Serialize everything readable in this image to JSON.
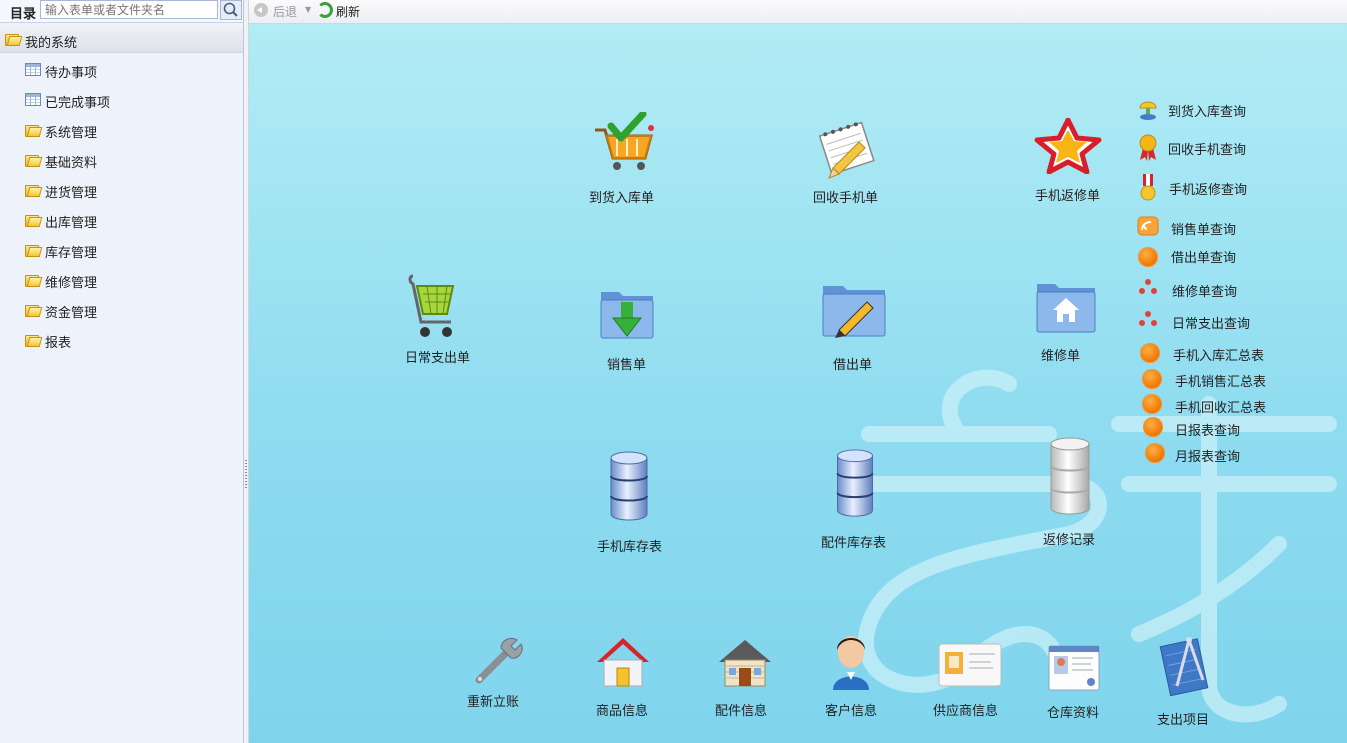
{
  "sidebar": {
    "search_label": "目录",
    "search_placeholder": "输入表单或者文件夹名",
    "root_label": "我的系统",
    "items": [
      {
        "label": "待办事项",
        "icon": "table-icon"
      },
      {
        "label": "已完成事项",
        "icon": "table-icon"
      },
      {
        "label": "系统管理",
        "icon": "folder-icon"
      },
      {
        "label": "基础资料",
        "icon": "folder-icon"
      },
      {
        "label": "进货管理",
        "icon": "folder-icon"
      },
      {
        "label": "出库管理",
        "icon": "folder-icon"
      },
      {
        "label": "库存管理",
        "icon": "folder-icon"
      },
      {
        "label": "维修管理",
        "icon": "folder-icon"
      },
      {
        "label": "资金管理",
        "icon": "folder-icon"
      },
      {
        "label": "报表",
        "icon": "folder-icon"
      }
    ]
  },
  "toolbar": {
    "back_label": "后退",
    "refresh_label": "刷新"
  },
  "tiles": [
    {
      "label": "到货入库单",
      "icon": "shopping-cart-check-icon"
    },
    {
      "label": "回收手机单",
      "icon": "notepad-pencil-icon"
    },
    {
      "label": "手机返修单",
      "icon": "star-icon"
    },
    {
      "label": "日常支出单",
      "icon": "green-cart-icon"
    },
    {
      "label": "销售单",
      "icon": "folder-download-icon"
    },
    {
      "label": "借出单",
      "icon": "folder-pencil-icon"
    },
    {
      "label": "维修单",
      "icon": "folder-home-icon"
    },
    {
      "label": "手机库存表",
      "icon": "database-icon"
    },
    {
      "label": "配件库存表",
      "icon": "database-icon"
    },
    {
      "label": "返修记录",
      "icon": "database-white-icon"
    },
    {
      "label": "重新立账",
      "icon": "wrench-icon"
    },
    {
      "label": "商品信息",
      "icon": "house-icon"
    },
    {
      "label": "配件信息",
      "icon": "cabin-icon"
    },
    {
      "label": "客户信息",
      "icon": "person-icon"
    },
    {
      "label": "供应商信息",
      "icon": "business-card-icon"
    },
    {
      "label": "仓库资料",
      "icon": "id-card-icon"
    },
    {
      "label": "支出项目",
      "icon": "blueprint-compass-icon"
    }
  ],
  "queries": [
    {
      "label": "到货入库查询",
      "icon": "lamp-icon"
    },
    {
      "label": "回收手机查询",
      "icon": "award-ribbon-icon"
    },
    {
      "label": "手机返修查询",
      "icon": "medal-icon"
    },
    {
      "label": "销售单查询",
      "icon": "rss-icon"
    },
    {
      "label": "借出单查询",
      "icon": "orange-dot-icon"
    },
    {
      "label": "维修单查询",
      "icon": "red-dots-icon"
    },
    {
      "label": "日常支出查询",
      "icon": "red-dots-icon"
    },
    {
      "label": "手机入库汇总表",
      "icon": "orange-dot-icon"
    },
    {
      "label": "手机销售汇总表",
      "icon": "orange-dot-icon"
    },
    {
      "label": "手机回收汇总表",
      "icon": "orange-dot-icon"
    },
    {
      "label": "日报表查询",
      "icon": "orange-dot-icon"
    },
    {
      "label": "月报表查询",
      "icon": "orange-dot-icon"
    }
  ]
}
